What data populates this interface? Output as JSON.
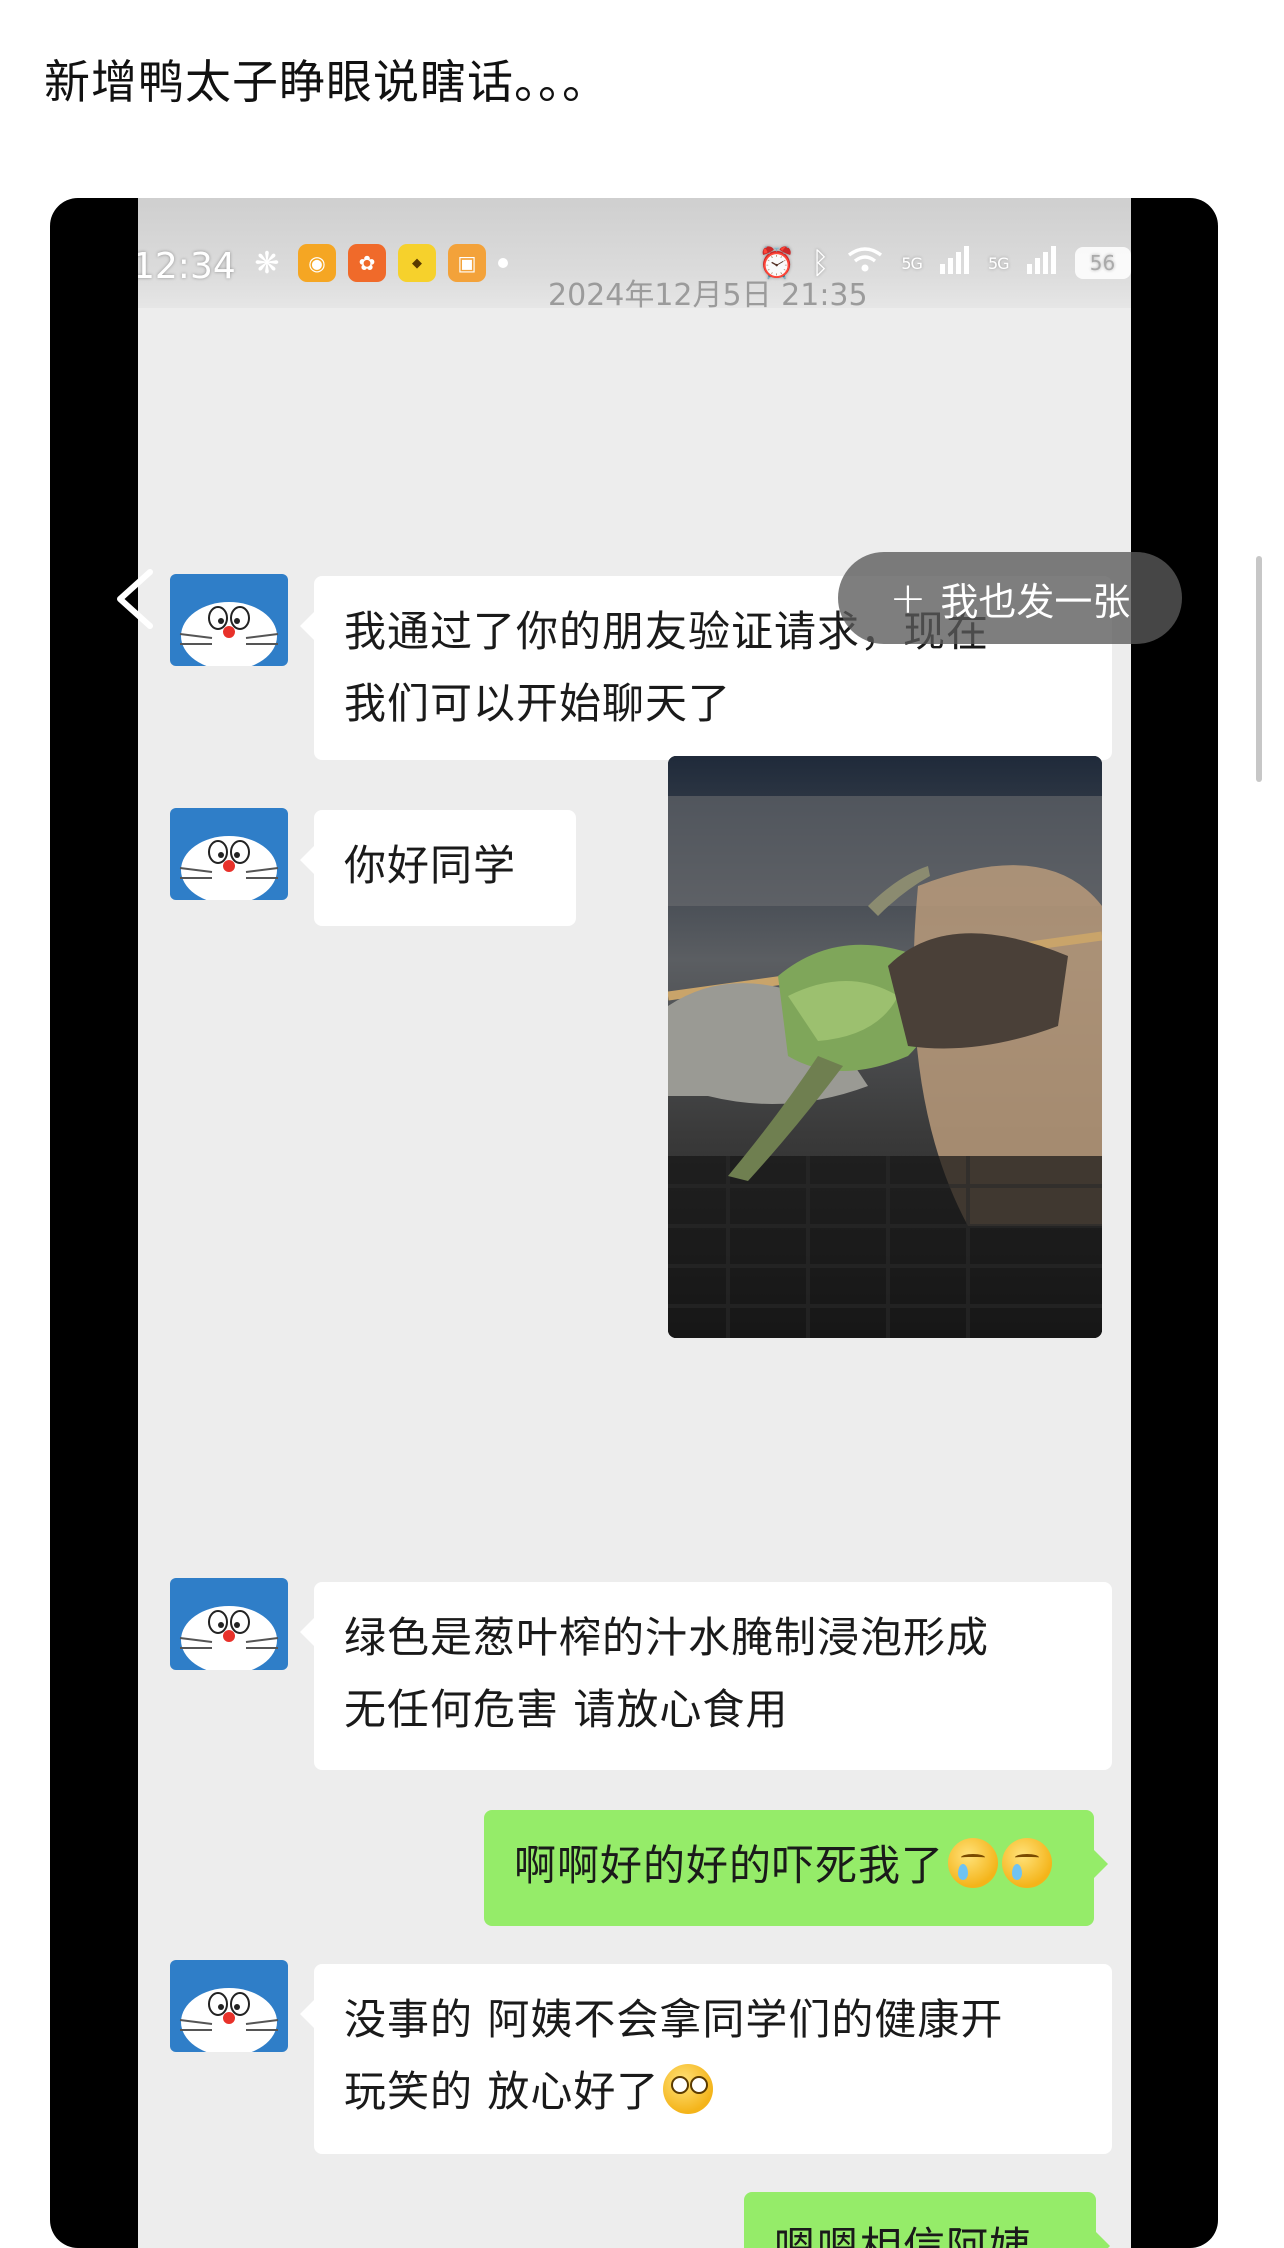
{
  "post": {
    "title": "新增鸭太子睁眼说瞎话。。。"
  },
  "status_bar": {
    "time": "12:34",
    "date_overlay": "2024年12月5日 21:35",
    "network_1": "5G",
    "network_2": "5G",
    "battery": "56"
  },
  "overlay": {
    "me_too_plus": "+",
    "me_too_label": "我也发一张"
  },
  "chat": {
    "messages": [
      {
        "side": "left",
        "text": "我通过了你的朋友验证请求，现在\n我们可以开始聊天了"
      },
      {
        "side": "left",
        "text": "你好同学"
      },
      {
        "side": "right",
        "type": "image",
        "icon": "food-skewer-photo"
      },
      {
        "side": "left",
        "text": "绿色是葱叶榨的汁水腌制浸泡形成\n无任何危害 请放心食用"
      },
      {
        "side": "right",
        "text": "啊啊好的好的吓死我了",
        "emoji": [
          "crying-face",
          "crying-face"
        ]
      },
      {
        "side": "left",
        "text": "没事的 阿姨不会拿同学们的健康开\n玩笑的 放心好了",
        "emoji": [
          "woozy-face"
        ]
      },
      {
        "side": "right",
        "text": "嗯嗯相信阿姨",
        "emoji": [
          "hand-emoji"
        ]
      }
    ]
  },
  "colors": {
    "chat_background": "#ededed",
    "bubble_left": "#ffffff",
    "bubble_right": "#95ec69",
    "avatar_blue": "#2f7ec8",
    "frame": "#000000"
  }
}
